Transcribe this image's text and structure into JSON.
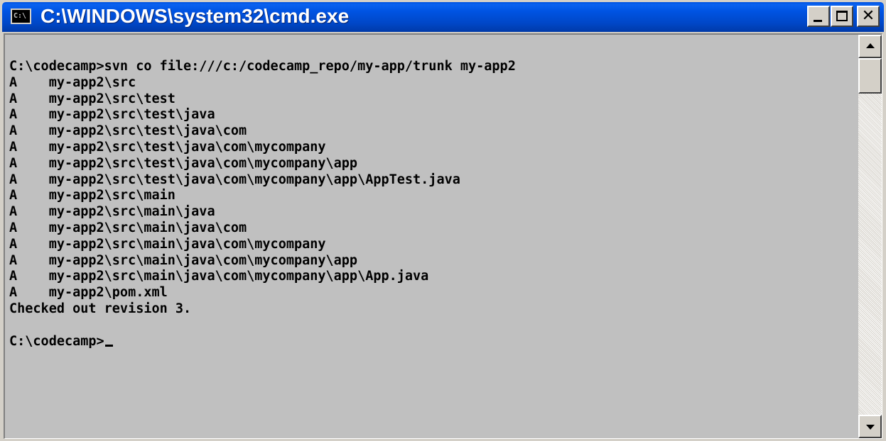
{
  "window": {
    "title": "C:\\WINDOWS\\system32\\cmd.exe",
    "icon": "cmd-icon",
    "icon_text": "C:\\",
    "controls": {
      "minimize_icon": "minimize-icon",
      "maximize_icon": "maximize-icon",
      "close_icon": "close-icon",
      "close_glyph": "✕"
    }
  },
  "console": {
    "lines": [
      "C:\\codecamp>svn co file:///c:/codecamp_repo/my-app/trunk my-app2",
      "A    my-app2\\src",
      "A    my-app2\\src\\test",
      "A    my-app2\\src\\test\\java",
      "A    my-app2\\src\\test\\java\\com",
      "A    my-app2\\src\\test\\java\\com\\mycompany",
      "A    my-app2\\src\\test\\java\\com\\mycompany\\app",
      "A    my-app2\\src\\test\\java\\com\\mycompany\\app\\AppTest.java",
      "A    my-app2\\src\\main",
      "A    my-app2\\src\\main\\java",
      "A    my-app2\\src\\main\\java\\com",
      "A    my-app2\\src\\main\\java\\com\\mycompany",
      "A    my-app2\\src\\main\\java\\com\\mycompany\\app",
      "A    my-app2\\src\\main\\java\\com\\mycompany\\app\\App.java",
      "A    my-app2\\pom.xml",
      "Checked out revision 3.",
      "",
      "C:\\codecamp>"
    ],
    "background_color": "#c0c0c0",
    "text_color": "#000000"
  },
  "scrollbar": {
    "up_icon": "scroll-up-arrow-icon",
    "down_icon": "scroll-down-arrow-icon"
  },
  "colors": {
    "titlebar": "#0054e3",
    "title_text": "#ffffff",
    "chrome": "#d4d0c8"
  }
}
